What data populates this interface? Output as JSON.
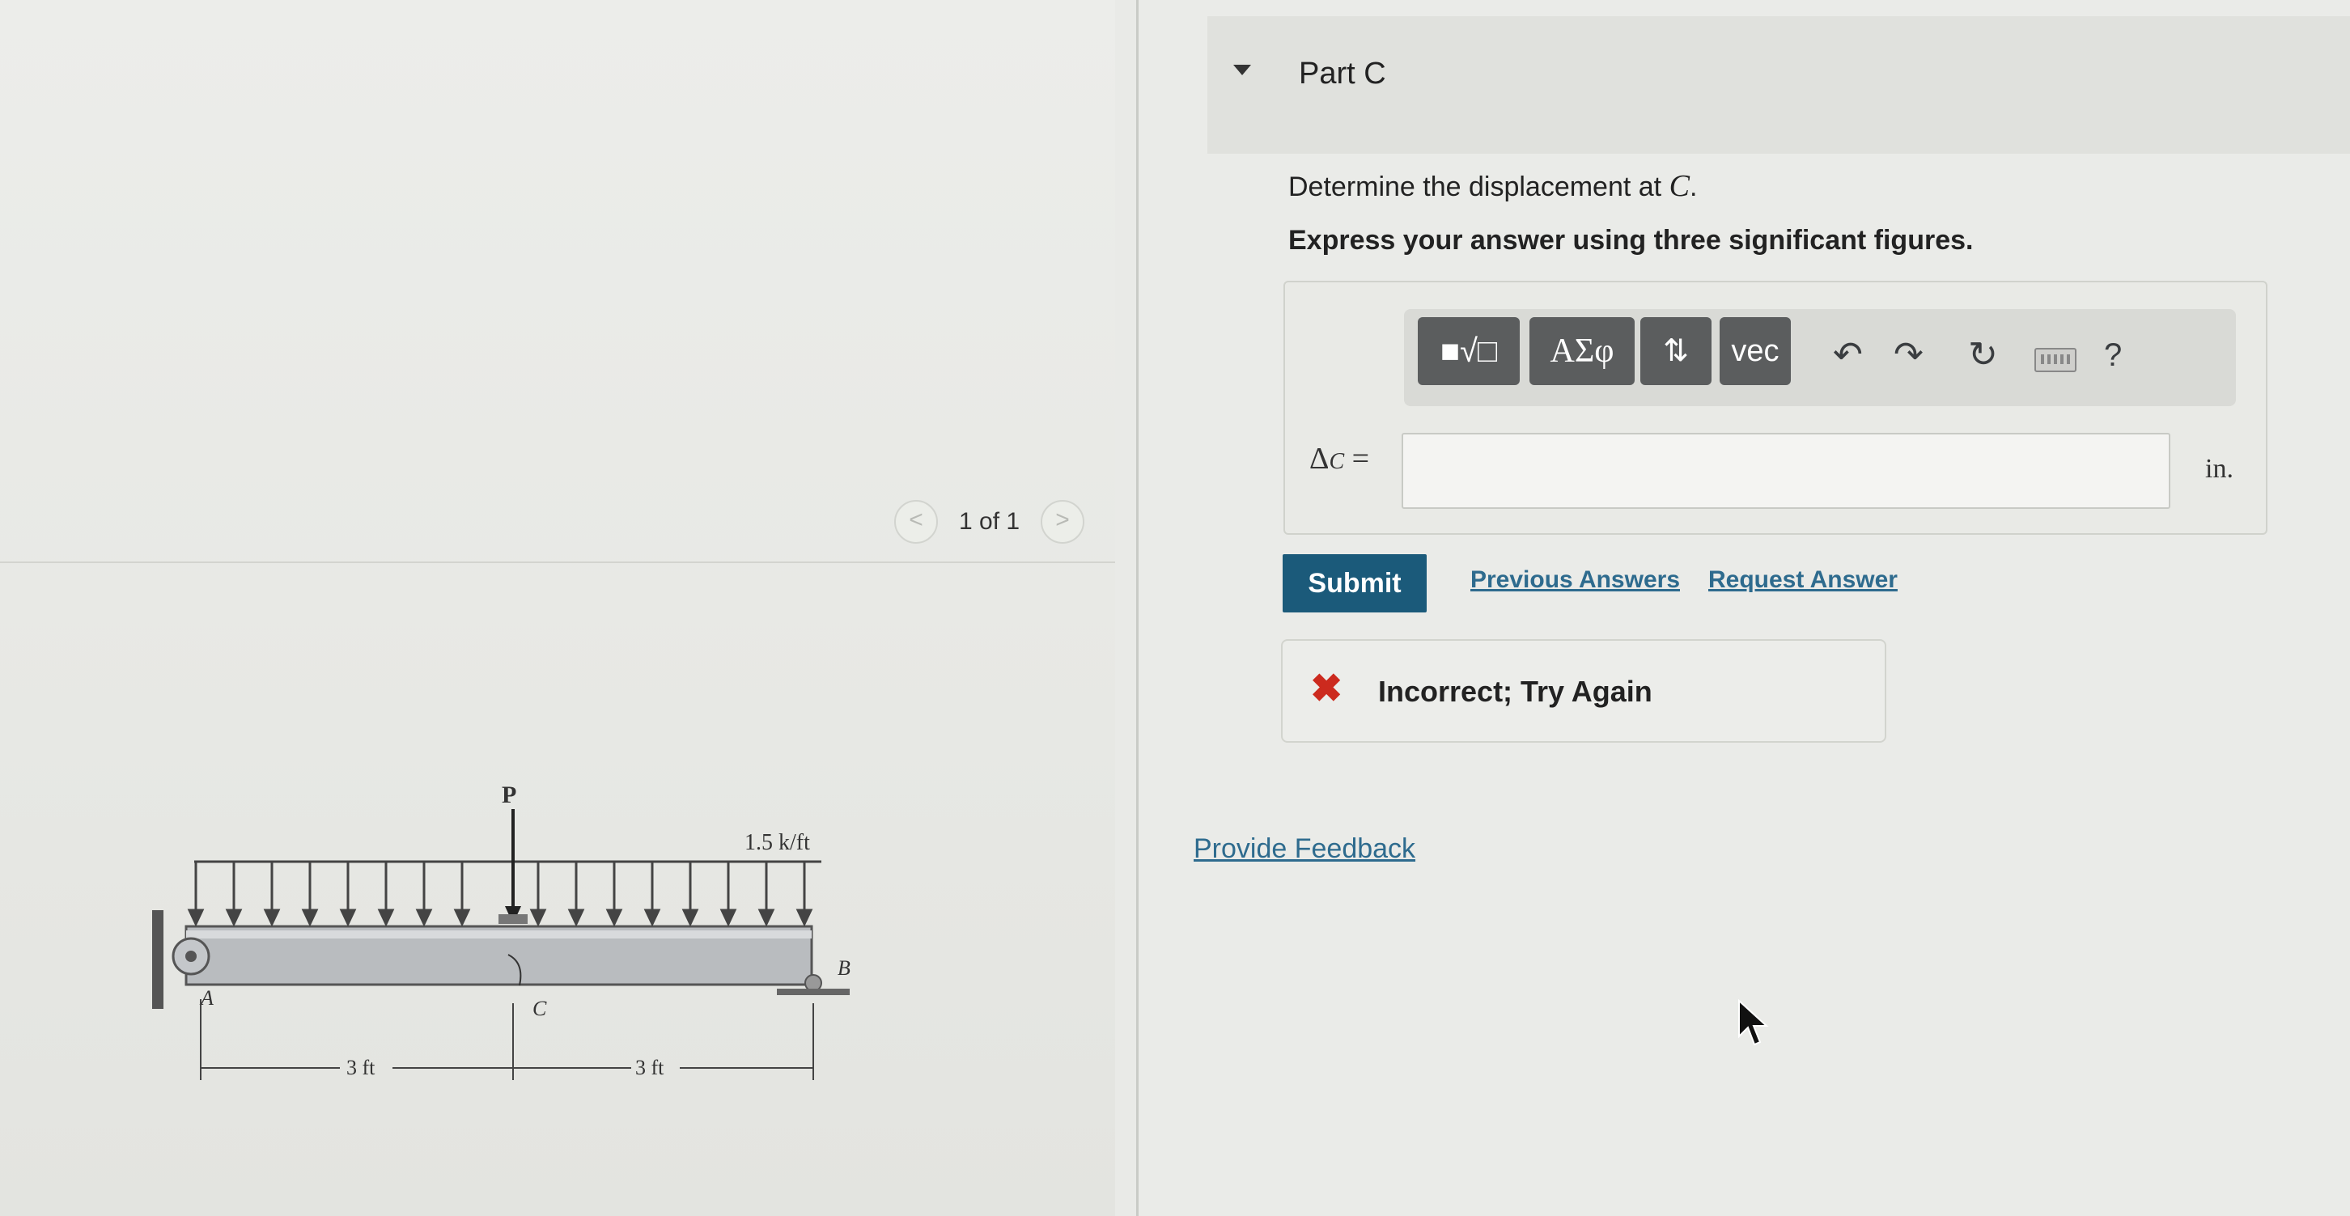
{
  "pager": {
    "prev": "<",
    "text": "1 of 1",
    "next": ">"
  },
  "figure": {
    "load_p": "P",
    "dist_load": "1.5 k/ft",
    "point_a": "A",
    "point_b": "B",
    "point_c": "C",
    "dim_left": "3 ft",
    "dim_right": "3 ft"
  },
  "part": {
    "title": "Part C"
  },
  "question": {
    "prompt_main": "Determine the displacement at ",
    "prompt_var": "C",
    "prompt_end": ".",
    "instruction": "Express your answer using three significant figures."
  },
  "toolbar": {
    "math_label": "■√□",
    "greek_label": "ΑΣφ",
    "arrows_label": "⇅",
    "vec_label": "vec",
    "undo": "↶",
    "redo": "↷",
    "reset": "↻",
    "help": "?"
  },
  "answer": {
    "delta": "Δ",
    "sub": "C",
    "equals": " =",
    "value": "",
    "unit": "in."
  },
  "actions": {
    "submit": "Submit",
    "previous_answers": "Previous Answers",
    "request_answer": "Request Answer"
  },
  "feedback": {
    "icon": "✖",
    "message": "Incorrect; Try Again"
  },
  "provide_feedback": "Provide Feedback",
  "colors": {
    "submit_bg": "#1b5a7a",
    "link": "#2e6b8e",
    "error": "#cc2a1e",
    "toolbar_button": "#5b5d5e"
  }
}
